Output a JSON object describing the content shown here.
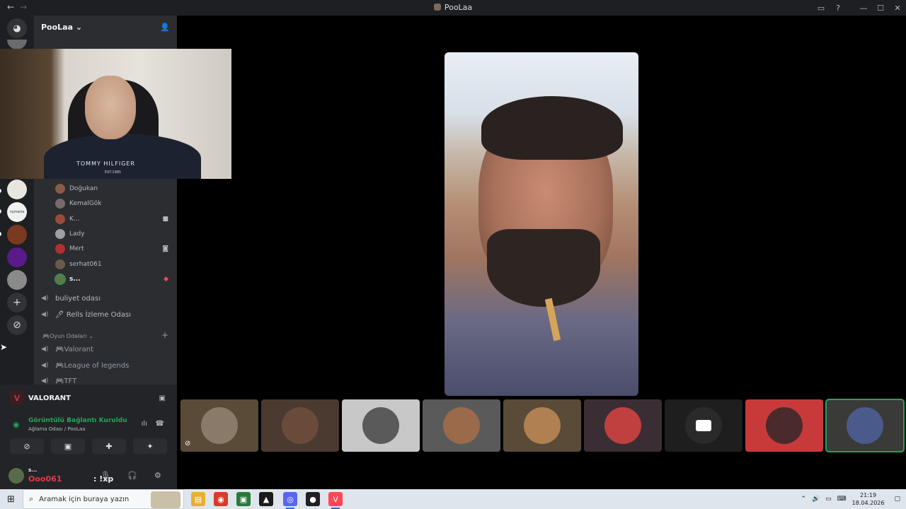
{
  "window": {
    "title": "PooLaa",
    "nav_back": "←",
    "nav_forward": "→",
    "controls": [
      "▭",
      "?",
      "—",
      "☐",
      "✕"
    ]
  },
  "servers": {
    "items": [
      {
        "name": "Discord Home",
        "icon": "discord-icon",
        "color": "#313338"
      },
      {
        "name": "Server 1",
        "icon": "server-avatar",
        "color": "#6b6b6b"
      },
      {
        "name": "Server 2",
        "icon": "server-avatar",
        "color": "#e8e6df"
      },
      {
        "name": "Server 3",
        "icon": "server-avatar",
        "color": "#f0f0f0"
      },
      {
        "name": "Server 4",
        "icon": "server-avatar",
        "color": "#7a3a20"
      },
      {
        "name": "Server 5",
        "icon": "server-avatar",
        "color": "#5a1a8a"
      },
      {
        "name": "Server 6",
        "icon": "server-avatar",
        "color": "#8a8a8a"
      }
    ],
    "server3_label": "nymeria",
    "add_label": "+",
    "explore_label": "⊘"
  },
  "guild": {
    "name": "PooLaa",
    "chevron": "⌄",
    "invite_icon": "add-member-icon"
  },
  "members": [
    {
      "name": "Doğukan",
      "color": "#8a5a4a"
    },
    {
      "name": "KemalGök",
      "color": "#7a6a6a"
    },
    {
      "name": "K...",
      "color": "#9a4a3a",
      "icon": "■"
    },
    {
      "name": "Lady",
      "color": "#a0a0a0"
    },
    {
      "name": "Mert",
      "color": "#b03030",
      "icon": "◙"
    },
    {
      "name": "serhat061",
      "color": "#6a5a4a"
    },
    {
      "name": "s...",
      "color": "#5a7a4a",
      "icon": "◆",
      "bold": true
    }
  ],
  "voice_channels": [
    {
      "name": "buliyet odası"
    },
    {
      "name": "🖊 Rells İzleme Odası"
    }
  ],
  "category": {
    "name": "🎮Oyun Odaları ⌄",
    "add": "+"
  },
  "game_channels": [
    {
      "name": "🎮Valorant"
    },
    {
      "name": "🎮League of legends"
    },
    {
      "name": "🎮TFT"
    }
  ],
  "activity": {
    "game": "VALORANT",
    "game_icon": "V",
    "screen_icon": "▣"
  },
  "voice": {
    "status": "Görüntülü Bağlantı Kuruldu",
    "room": "Ağlama Odası / PooLaa",
    "signal_icon": "◉",
    "wave_icon": "ılı",
    "hangup_icon": "☎"
  },
  "voice_buttons": [
    "⊘",
    "▣",
    "✚",
    "✦"
  ],
  "user": {
    "short_name": "s...",
    "overlay_name": "Ooo061",
    "overlay_cmd": ": !xp",
    "mic_icon": "🎙",
    "headset_icon": "🎧",
    "settings_icon": "⚙"
  },
  "tiles": [
    {
      "color": "#5a4a38",
      "avatar": "#8a7a6a",
      "muted": true
    },
    {
      "color": "#4a3a30",
      "avatar": "#6a4a3a"
    },
    {
      "color": "#c8c8c8",
      "avatar": "#5a5a5a"
    },
    {
      "color": "#5a5a5a",
      "avatar": "#9a6a4a"
    },
    {
      "color": "#5a4a38",
      "avatar": "#b08050"
    },
    {
      "color": "#3a2e34",
      "avatar": "#c04040"
    },
    {
      "color": "#1e1e1e",
      "avatar": "#2a2a2a",
      "camera": true
    },
    {
      "color": "#c83a3a",
      "avatar": "#4a2a2a"
    },
    {
      "color": "#3a3a38",
      "avatar": "#4a5a8a",
      "active": true
    }
  ],
  "webcam": {
    "brand": "TOMMY HILFIGER",
    "sub": "EST.1985"
  },
  "taskbar": {
    "search_placeholder": "Aramak için buraya yazın",
    "start_icon": "⊞",
    "search_icon": "⌕",
    "apps": [
      {
        "name": "file-explorer",
        "glyph": "▤",
        "color": "#e8b030"
      },
      {
        "name": "chrome",
        "glyph": "◉",
        "color": "#d93a2a"
      },
      {
        "name": "app-green",
        "glyph": "▣",
        "color": "#2a7a3a"
      },
      {
        "name": "app-dark",
        "glyph": "▲",
        "color": "#1b1b1b"
      },
      {
        "name": "discord",
        "glyph": "◎",
        "color": "#5865f2"
      },
      {
        "name": "app-red",
        "glyph": "●",
        "color": "#202020"
      },
      {
        "name": "valorant",
        "glyph": "V",
        "color": "#ff4655"
      }
    ],
    "tray_icons": [
      "⌃",
      "🔊",
      "▭",
      "⌨"
    ],
    "time": "21:19",
    "date": "18.04.2026",
    "notification_icon": "▢"
  }
}
